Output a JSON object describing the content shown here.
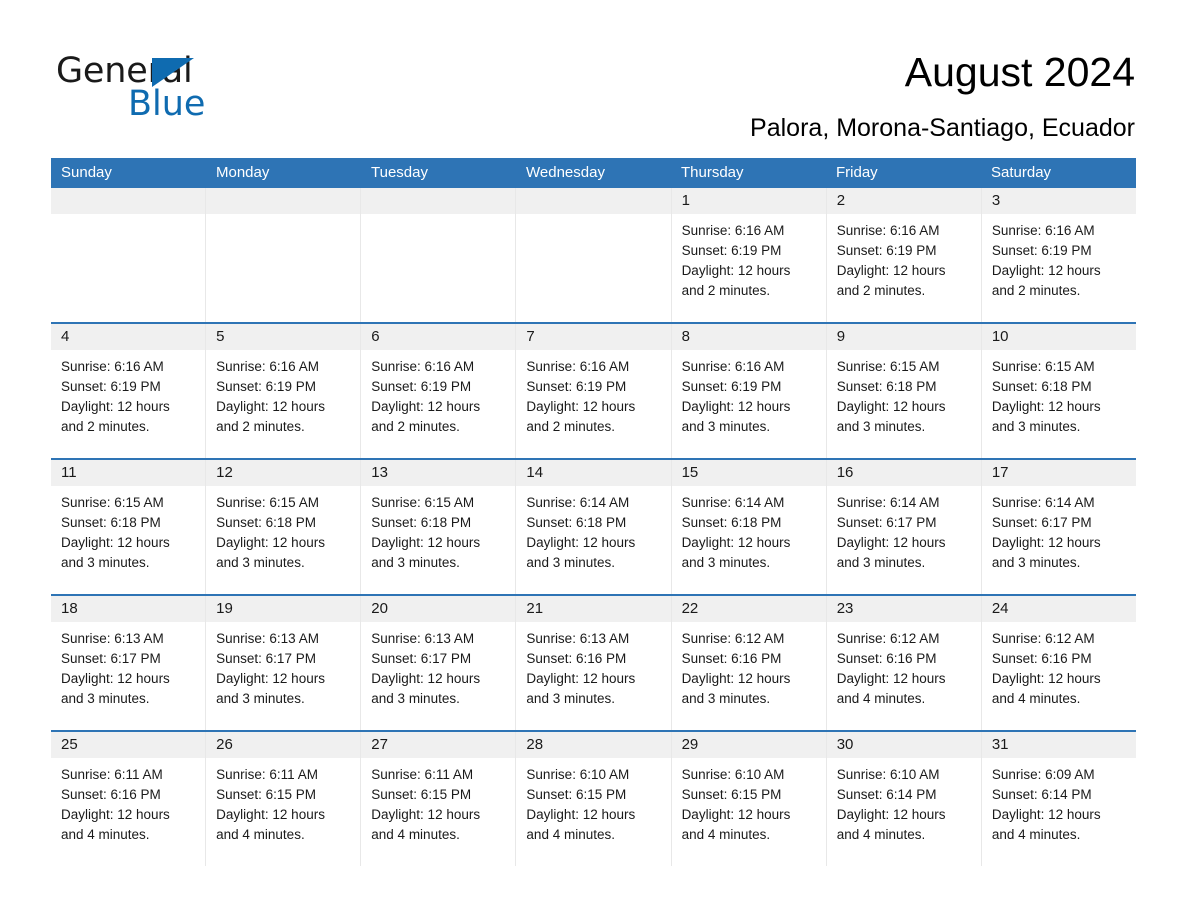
{
  "brand": {
    "name_part1": "General",
    "name_part2": "Blue",
    "triangle_color": "#0f6bb0",
    "accent_color": "#2e74b5"
  },
  "header": {
    "title": "August 2024",
    "subtitle": "Palora, Morona-Santiago, Ecuador"
  },
  "calendar": {
    "weekday_headers": [
      "Sunday",
      "Monday",
      "Tuesday",
      "Wednesday",
      "Thursday",
      "Friday",
      "Saturday"
    ],
    "header_bg": "#2e74b5",
    "header_text_color": "#ffffff",
    "daynum_band_bg": "#f0f0f0",
    "weeks": [
      [
        {
          "day": "",
          "sunrise": "",
          "sunset": "",
          "daylight_line1": "",
          "daylight_line2": ""
        },
        {
          "day": "",
          "sunrise": "",
          "sunset": "",
          "daylight_line1": "",
          "daylight_line2": ""
        },
        {
          "day": "",
          "sunrise": "",
          "sunset": "",
          "daylight_line1": "",
          "daylight_line2": ""
        },
        {
          "day": "",
          "sunrise": "",
          "sunset": "",
          "daylight_line1": "",
          "daylight_line2": ""
        },
        {
          "day": "1",
          "sunrise": "Sunrise: 6:16 AM",
          "sunset": "Sunset: 6:19 PM",
          "daylight_line1": "Daylight: 12 hours",
          "daylight_line2": "and 2 minutes."
        },
        {
          "day": "2",
          "sunrise": "Sunrise: 6:16 AM",
          "sunset": "Sunset: 6:19 PM",
          "daylight_line1": "Daylight: 12 hours",
          "daylight_line2": "and 2 minutes."
        },
        {
          "day": "3",
          "sunrise": "Sunrise: 6:16 AM",
          "sunset": "Sunset: 6:19 PM",
          "daylight_line1": "Daylight: 12 hours",
          "daylight_line2": "and 2 minutes."
        }
      ],
      [
        {
          "day": "4",
          "sunrise": "Sunrise: 6:16 AM",
          "sunset": "Sunset: 6:19 PM",
          "daylight_line1": "Daylight: 12 hours",
          "daylight_line2": "and 2 minutes."
        },
        {
          "day": "5",
          "sunrise": "Sunrise: 6:16 AM",
          "sunset": "Sunset: 6:19 PM",
          "daylight_line1": "Daylight: 12 hours",
          "daylight_line2": "and 2 minutes."
        },
        {
          "day": "6",
          "sunrise": "Sunrise: 6:16 AM",
          "sunset": "Sunset: 6:19 PM",
          "daylight_line1": "Daylight: 12 hours",
          "daylight_line2": "and 2 minutes."
        },
        {
          "day": "7",
          "sunrise": "Sunrise: 6:16 AM",
          "sunset": "Sunset: 6:19 PM",
          "daylight_line1": "Daylight: 12 hours",
          "daylight_line2": "and 2 minutes."
        },
        {
          "day": "8",
          "sunrise": "Sunrise: 6:16 AM",
          "sunset": "Sunset: 6:19 PM",
          "daylight_line1": "Daylight: 12 hours",
          "daylight_line2": "and 3 minutes."
        },
        {
          "day": "9",
          "sunrise": "Sunrise: 6:15 AM",
          "sunset": "Sunset: 6:18 PM",
          "daylight_line1": "Daylight: 12 hours",
          "daylight_line2": "and 3 minutes."
        },
        {
          "day": "10",
          "sunrise": "Sunrise: 6:15 AM",
          "sunset": "Sunset: 6:18 PM",
          "daylight_line1": "Daylight: 12 hours",
          "daylight_line2": "and 3 minutes."
        }
      ],
      [
        {
          "day": "11",
          "sunrise": "Sunrise: 6:15 AM",
          "sunset": "Sunset: 6:18 PM",
          "daylight_line1": "Daylight: 12 hours",
          "daylight_line2": "and 3 minutes."
        },
        {
          "day": "12",
          "sunrise": "Sunrise: 6:15 AM",
          "sunset": "Sunset: 6:18 PM",
          "daylight_line1": "Daylight: 12 hours",
          "daylight_line2": "and 3 minutes."
        },
        {
          "day": "13",
          "sunrise": "Sunrise: 6:15 AM",
          "sunset": "Sunset: 6:18 PM",
          "daylight_line1": "Daylight: 12 hours",
          "daylight_line2": "and 3 minutes."
        },
        {
          "day": "14",
          "sunrise": "Sunrise: 6:14 AM",
          "sunset": "Sunset: 6:18 PM",
          "daylight_line1": "Daylight: 12 hours",
          "daylight_line2": "and 3 minutes."
        },
        {
          "day": "15",
          "sunrise": "Sunrise: 6:14 AM",
          "sunset": "Sunset: 6:18 PM",
          "daylight_line1": "Daylight: 12 hours",
          "daylight_line2": "and 3 minutes."
        },
        {
          "day": "16",
          "sunrise": "Sunrise: 6:14 AM",
          "sunset": "Sunset: 6:17 PM",
          "daylight_line1": "Daylight: 12 hours",
          "daylight_line2": "and 3 minutes."
        },
        {
          "day": "17",
          "sunrise": "Sunrise: 6:14 AM",
          "sunset": "Sunset: 6:17 PM",
          "daylight_line1": "Daylight: 12 hours",
          "daylight_line2": "and 3 minutes."
        }
      ],
      [
        {
          "day": "18",
          "sunrise": "Sunrise: 6:13 AM",
          "sunset": "Sunset: 6:17 PM",
          "daylight_line1": "Daylight: 12 hours",
          "daylight_line2": "and 3 minutes."
        },
        {
          "day": "19",
          "sunrise": "Sunrise: 6:13 AM",
          "sunset": "Sunset: 6:17 PM",
          "daylight_line1": "Daylight: 12 hours",
          "daylight_line2": "and 3 minutes."
        },
        {
          "day": "20",
          "sunrise": "Sunrise: 6:13 AM",
          "sunset": "Sunset: 6:17 PM",
          "daylight_line1": "Daylight: 12 hours",
          "daylight_line2": "and 3 minutes."
        },
        {
          "day": "21",
          "sunrise": "Sunrise: 6:13 AM",
          "sunset": "Sunset: 6:16 PM",
          "daylight_line1": "Daylight: 12 hours",
          "daylight_line2": "and 3 minutes."
        },
        {
          "day": "22",
          "sunrise": "Sunrise: 6:12 AM",
          "sunset": "Sunset: 6:16 PM",
          "daylight_line1": "Daylight: 12 hours",
          "daylight_line2": "and 3 minutes."
        },
        {
          "day": "23",
          "sunrise": "Sunrise: 6:12 AM",
          "sunset": "Sunset: 6:16 PM",
          "daylight_line1": "Daylight: 12 hours",
          "daylight_line2": "and 4 minutes."
        },
        {
          "day": "24",
          "sunrise": "Sunrise: 6:12 AM",
          "sunset": "Sunset: 6:16 PM",
          "daylight_line1": "Daylight: 12 hours",
          "daylight_line2": "and 4 minutes."
        }
      ],
      [
        {
          "day": "25",
          "sunrise": "Sunrise: 6:11 AM",
          "sunset": "Sunset: 6:16 PM",
          "daylight_line1": "Daylight: 12 hours",
          "daylight_line2": "and 4 minutes."
        },
        {
          "day": "26",
          "sunrise": "Sunrise: 6:11 AM",
          "sunset": "Sunset: 6:15 PM",
          "daylight_line1": "Daylight: 12 hours",
          "daylight_line2": "and 4 minutes."
        },
        {
          "day": "27",
          "sunrise": "Sunrise: 6:11 AM",
          "sunset": "Sunset: 6:15 PM",
          "daylight_line1": "Daylight: 12 hours",
          "daylight_line2": "and 4 minutes."
        },
        {
          "day": "28",
          "sunrise": "Sunrise: 6:10 AM",
          "sunset": "Sunset: 6:15 PM",
          "daylight_line1": "Daylight: 12 hours",
          "daylight_line2": "and 4 minutes."
        },
        {
          "day": "29",
          "sunrise": "Sunrise: 6:10 AM",
          "sunset": "Sunset: 6:15 PM",
          "daylight_line1": "Daylight: 12 hours",
          "daylight_line2": "and 4 minutes."
        },
        {
          "day": "30",
          "sunrise": "Sunrise: 6:10 AM",
          "sunset": "Sunset: 6:14 PM",
          "daylight_line1": "Daylight: 12 hours",
          "daylight_line2": "and 4 minutes."
        },
        {
          "day": "31",
          "sunrise": "Sunrise: 6:09 AM",
          "sunset": "Sunset: 6:14 PM",
          "daylight_line1": "Daylight: 12 hours",
          "daylight_line2": "and 4 minutes."
        }
      ]
    ]
  }
}
